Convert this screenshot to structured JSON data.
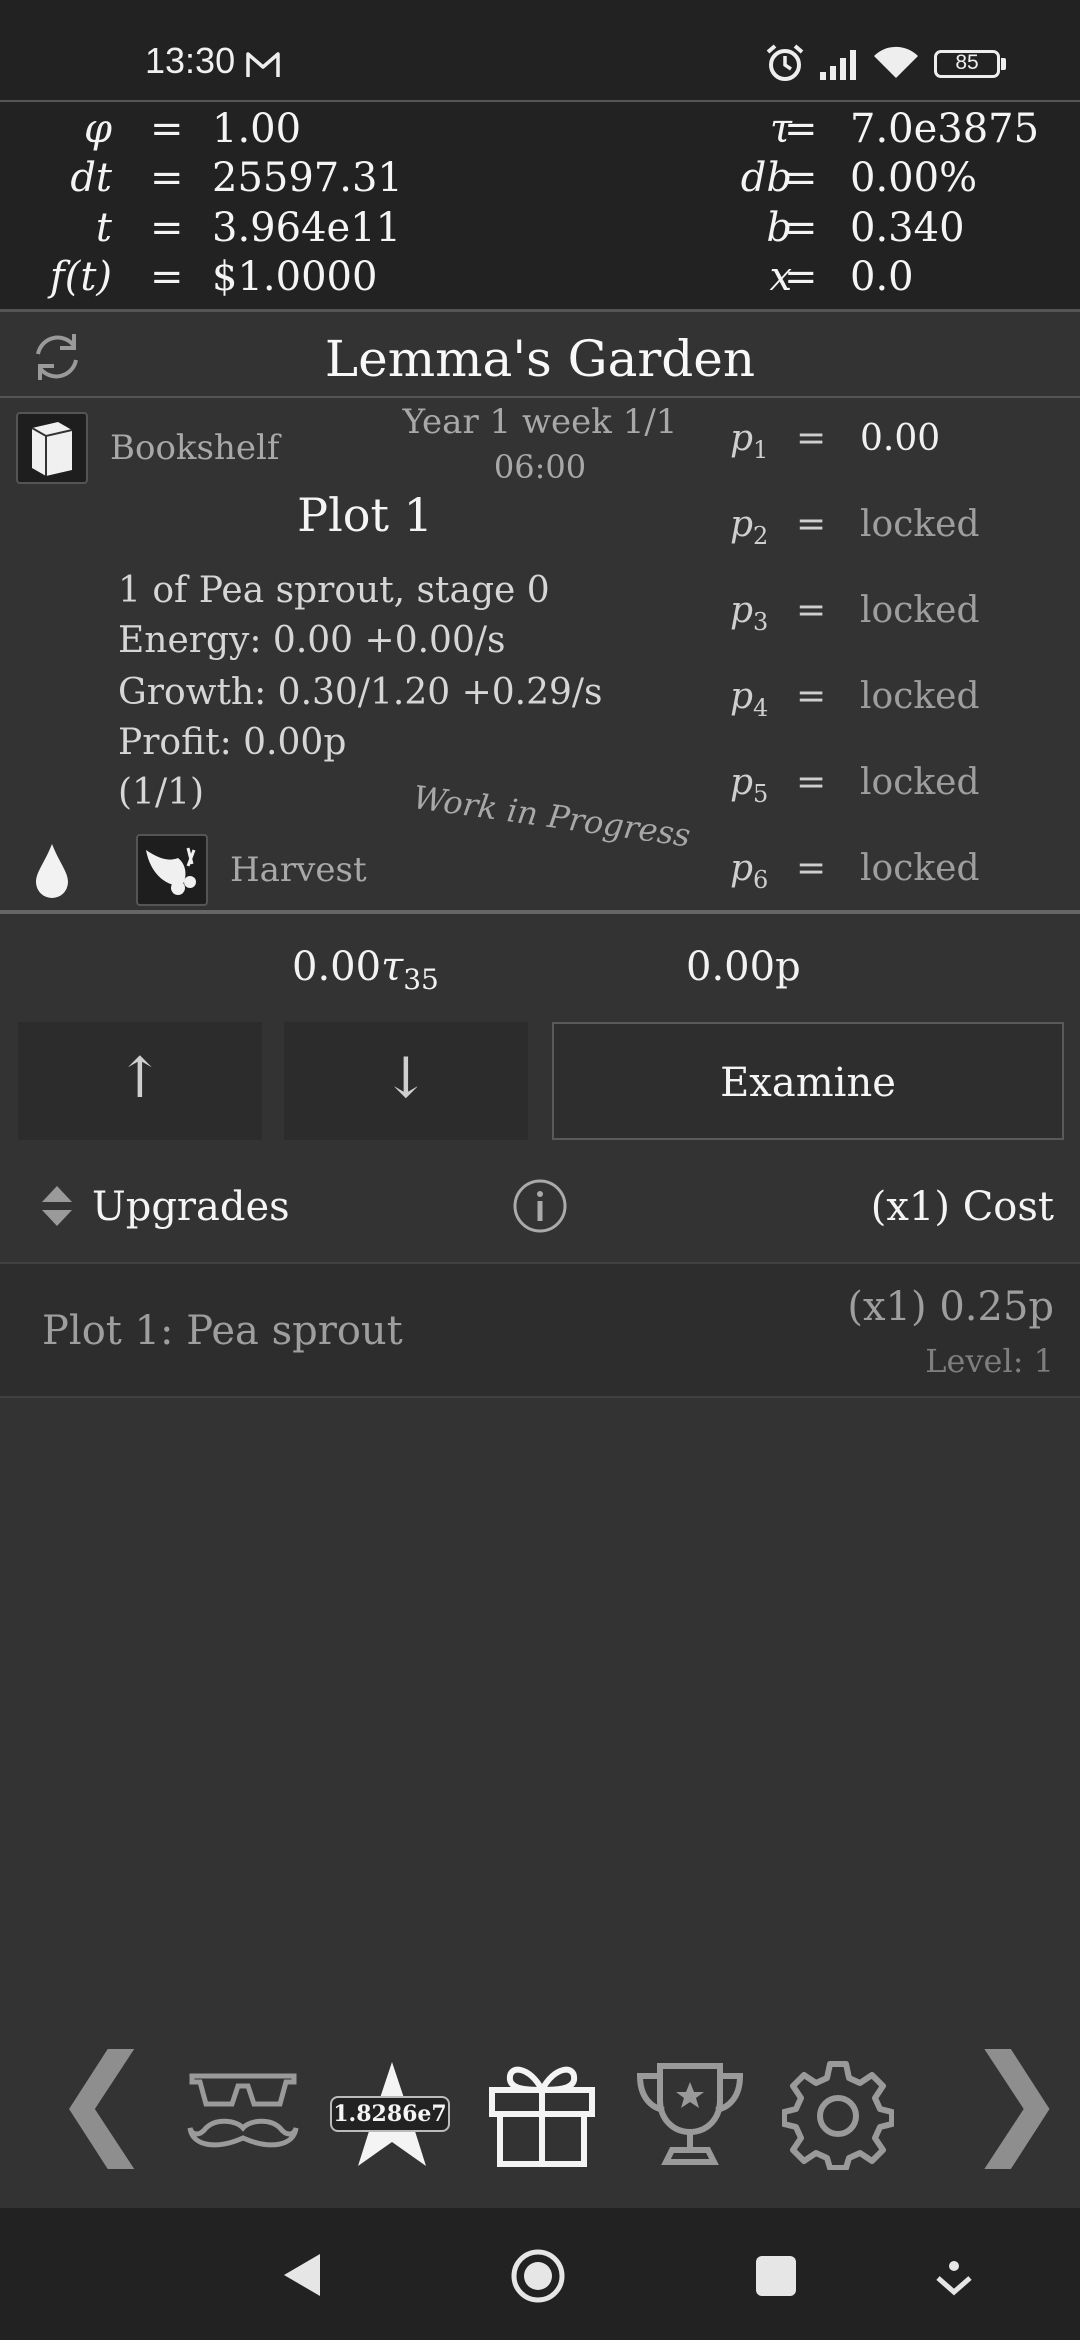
{
  "status": {
    "time": "13:30",
    "battery": "85"
  },
  "vars": {
    "left": [
      {
        "lhs": "φ",
        "eq": "=",
        "rhs": "1.00"
      },
      {
        "lhs": "dt",
        "eq": "=",
        "rhs": "25597.31"
      },
      {
        "lhs": "t",
        "eq": "=",
        "rhs": "3.964e11"
      },
      {
        "lhs": "f(t)",
        "eq": "=",
        "rhs": "$1.0000"
      }
    ],
    "right": [
      {
        "lhs": "τ",
        "eq": "=",
        "rhs": "7.0e3875"
      },
      {
        "lhs": "db",
        "eq": "=",
        "rhs": "0.00%"
      },
      {
        "lhs": "b",
        "eq": "=",
        "rhs": "0.340"
      },
      {
        "lhs": "x",
        "eq": "=",
        "rhs": "0.0"
      }
    ]
  },
  "garden": {
    "title": "Lemma's Garden",
    "bookshelf_label": "Bookshelf",
    "date_line1": "Year 1 week 1/1",
    "date_line2": "06:00",
    "plot_title": "Plot 1",
    "line1": "1 of Pea sprout, stage 0",
    "line2": "Energy: 0.00  +0.00/s",
    "line3": "Growth: 0.30/1.20  +0.29/s",
    "line4": "Profit: 0.00p",
    "line5": "(1/1)",
    "wip": "Work in Progress",
    "harvest_label": "Harvest",
    "p_vars": [
      {
        "name": "p",
        "sub": "1",
        "eq": "=",
        "value": "0.00"
      },
      {
        "name": "p",
        "sub": "2",
        "eq": "=",
        "value": "locked"
      },
      {
        "name": "p",
        "sub": "3",
        "eq": "=",
        "value": "locked"
      },
      {
        "name": "p",
        "sub": "4",
        "eq": "=",
        "value": "locked"
      },
      {
        "name": "p",
        "sub": "5",
        "eq": "=",
        "value": "locked"
      },
      {
        "name": "p",
        "sub": "6",
        "eq": "=",
        "value": "locked"
      }
    ]
  },
  "currency": {
    "tau_value": "0.00",
    "tau_symbol": "τ",
    "tau_sub": "35",
    "p_value": "0.00p"
  },
  "buttons": {
    "up": "↑",
    "down": "↓",
    "examine": "Examine"
  },
  "upgrades": {
    "header": "Upgrades",
    "cost_label": "(x1) Cost",
    "items": [
      {
        "name": "Plot 1: Pea sprout",
        "cost": "(x1) 0.25p",
        "level": "Level: 1"
      }
    ]
  },
  "bottom_nav": {
    "star_badge": "1.8286e7",
    "prev": "❮",
    "next": "❯"
  },
  "colors": {
    "bg": "#333333",
    "panel": "#222222",
    "text": "#f2f2f2",
    "dim": "#a8a8a8"
  }
}
